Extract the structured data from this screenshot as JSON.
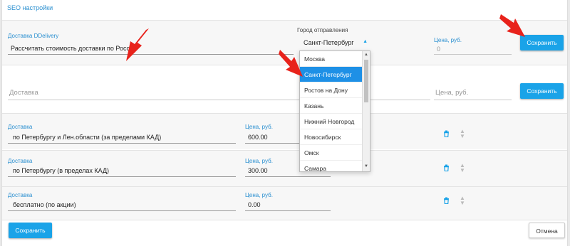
{
  "header": {
    "seo_link": "SEO настройки"
  },
  "top_row": {
    "name_label": "Доставка DDelivery",
    "name_value": "Рассчитать стоимость доставки по России",
    "city_label": "Город отправления",
    "city_value": "Санкт-Петербург",
    "price_label": "Цена, руб.",
    "price_value": "0",
    "save_label": "Сохранить"
  },
  "city_dropdown": {
    "options": [
      "Москва",
      "Санкт-Петербург",
      "Ростов на Дону",
      "Казань",
      "Нижний Новгород",
      "Новосибирск",
      "Омск",
      "Самара"
    ],
    "selected": "Санкт-Петербург"
  },
  "new_row": {
    "name_placeholder": "Доставка",
    "price_placeholder": "Цена, руб.",
    "save_label": "Сохранить"
  },
  "rows": [
    {
      "name_label": "Доставка",
      "name_value": "по Петербургу и Лен.области (за пределами КАД)",
      "price_label": "Цена, руб.",
      "price_value": "600.00"
    },
    {
      "name_label": "Доставка",
      "name_value": "по Петербургу (в пределах КАД)",
      "price_label": "Цена, руб.",
      "price_value": "300.00"
    },
    {
      "name_label": "Доставка",
      "name_value": "бесплатно (по акции)",
      "price_label": "Цена, руб.",
      "price_value": "0.00"
    }
  ],
  "footer": {
    "save_label": "Сохранить",
    "cancel_label": "Отмена"
  },
  "colors": {
    "accent": "#1aa3e8",
    "selected": "#1e90e6",
    "arrow": "#e8221b"
  },
  "icons": [
    "trash-icon",
    "sort-arrows-icon",
    "dropdown-caret-icon",
    "annotation-arrow-icon"
  ]
}
